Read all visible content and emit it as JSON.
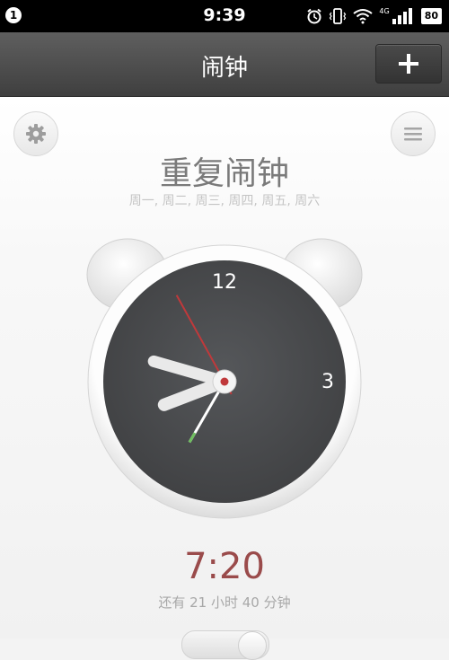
{
  "status_bar": {
    "notification_count": "1",
    "time": "9:39",
    "network": "4G",
    "battery": "80",
    "icons": [
      "alarm-icon",
      "vibrate-icon",
      "wifi-icon",
      "signal-icon",
      "battery-icon"
    ]
  },
  "header": {
    "title": "闹钟",
    "add_icon": "plus-icon"
  },
  "alarm": {
    "title": "重复闹钟",
    "days": "周一, 周二, 周三, 周四, 周五, 周六",
    "time": "7:20",
    "remaining": "还有 21 小时 40 分钟",
    "enabled": true
  },
  "clock": {
    "label_12": "12",
    "label_3": "3",
    "hour_hand_angle": 249,
    "minute_hand_angle": 286,
    "second_hand_angle": 331,
    "alarm_hand_angle": 210
  },
  "colors": {
    "header": "#4a4a4a",
    "clock_face": "#4a4b4d",
    "second_hand": "#c0393b",
    "alarm_time": "#9a4b4b",
    "alarm_hand_tip": "#6fbf5f"
  }
}
